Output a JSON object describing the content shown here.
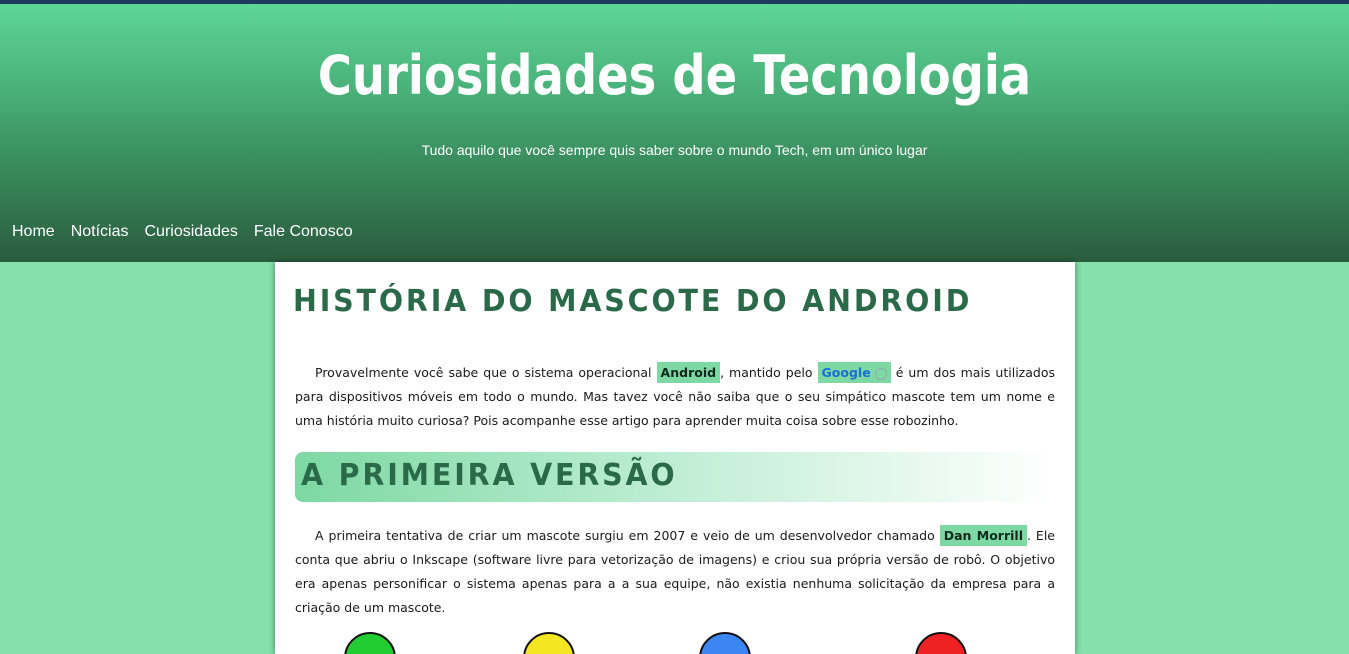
{
  "header": {
    "title": "Curiosidades de Tecnologia",
    "subtitle": "Tudo aquilo que você sempre quis saber sobre o mundo Tech, em um único lugar"
  },
  "nav": {
    "items": [
      {
        "label": "Home"
      },
      {
        "label": "Notícias"
      },
      {
        "label": "Curiosidades"
      },
      {
        "label": "Fale Conosco"
      }
    ]
  },
  "article": {
    "title": "História do mascote do Android",
    "intro": {
      "part1": "Provavelmente você sabe que o sistema operacional ",
      "highlight1": "Android",
      "part2": ", mantido pelo ",
      "link": "Google",
      "part3": " é um dos mais utilizados para dispositivos móveis em todo o mundo. Mas tavez você não saiba que o seu simpático mascote tem um nome e uma história muito curiosa? Pois acompanhe esse artigo para aprender muita coisa sobre esse robozinho."
    },
    "section1": {
      "title": "A primeira versão",
      "part1": "A primeira tentativa de criar um mascote surgiu em 2007 e veio de um desenvolvedor chamado ",
      "highlight": "Dan Morrill",
      "part2": ". Ele conta que abriu o Inkscape (software livre para vetorização de imagens) e criou sua própria versão de robô. O objetivo era apenas personificar o sistema apenas para a a sua equipe, não existia nenhuma solicitação da empresa para a criação de um mascote."
    }
  },
  "colors": {
    "background": "#85e0ac",
    "accent": "#2a6a48",
    "highlight": "#7dd8a3",
    "topbar": "#1e3a5c"
  },
  "icons": {
    "external_link": "external-link-icon"
  }
}
